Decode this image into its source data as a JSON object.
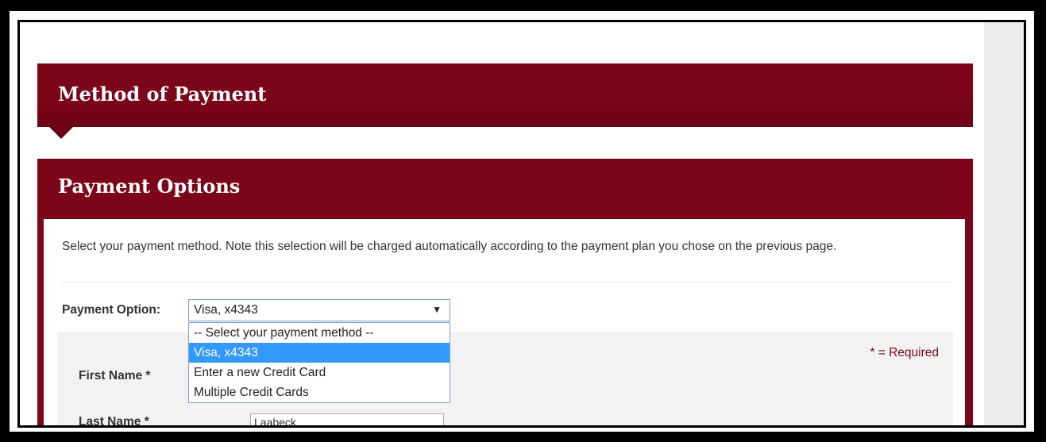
{
  "sections": {
    "method_of_payment_title": "Method of Payment",
    "payment_options_title": "Payment Options"
  },
  "intro_text": "Select your payment method. Note this selection will be charged automatically according to the payment plan you chose on the previous page.",
  "payment_option": {
    "label": "Payment Option:",
    "selected_value": "Visa, x4343",
    "options": [
      "-- Select your payment method --",
      "Visa, x4343",
      "Enter a new Credit Card",
      "Multiple Credit Cards"
    ],
    "highlighted_index": 1
  },
  "form": {
    "required_note": "* = Required",
    "first_name_label": "First Name *",
    "last_name_label": "Last Name *",
    "last_name_value": "Laabeck"
  },
  "colors": {
    "brand": "#7d0519",
    "highlight": "#3399ff"
  }
}
